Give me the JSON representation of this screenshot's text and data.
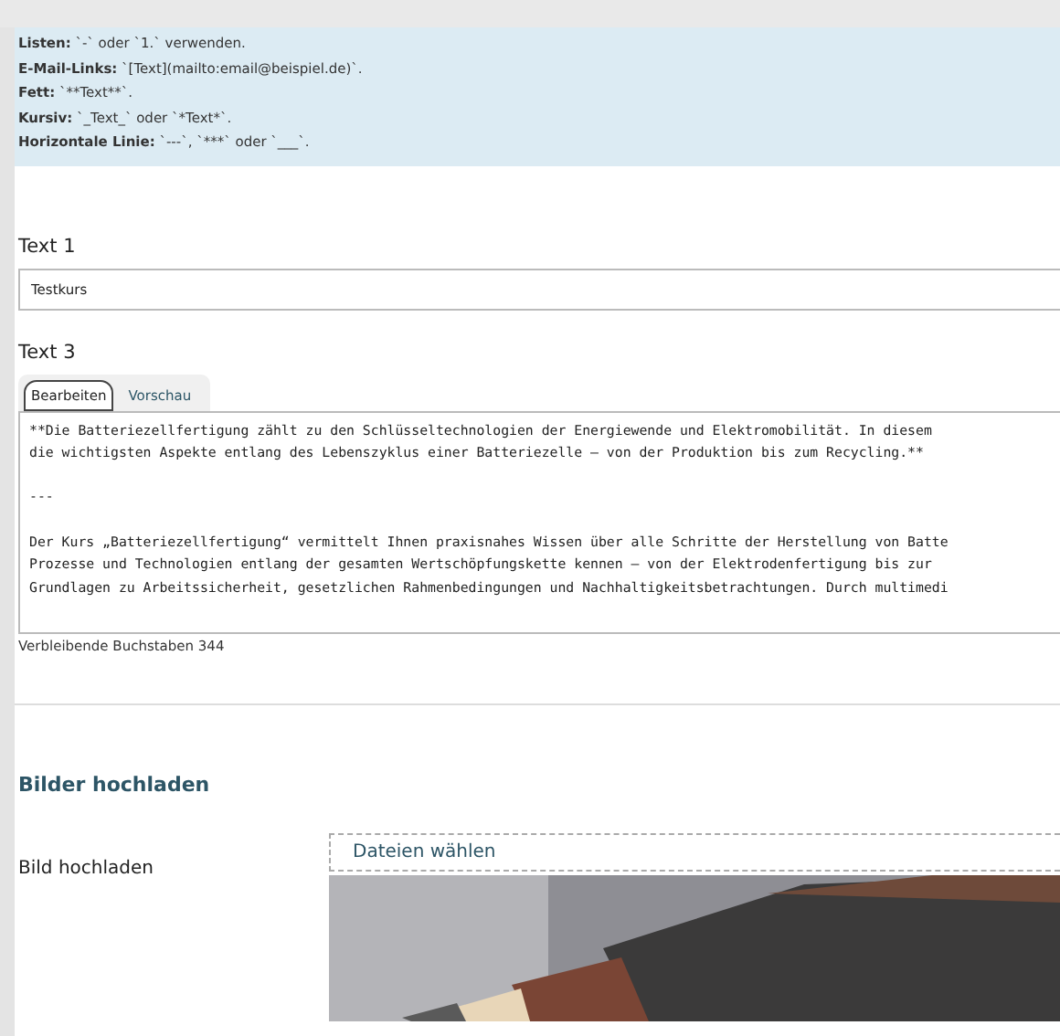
{
  "help_lines": [
    {
      "label": "Listen:",
      "text": "`-` oder `1.` verwenden."
    },
    {
      "label": "E-Mail-Links:",
      "text": "`[Text](mailto:email@beispiel.de)`."
    },
    {
      "label": "Fett:",
      "text": "`**Text**`."
    },
    {
      "label": "Kursiv:",
      "text": "`_Text_` oder `*Text*`."
    },
    {
      "label": "Horizontale Linie:",
      "text": "`---`, `***` oder `___`."
    }
  ],
  "text1": {
    "label": "Text 1",
    "value": "Testkurs"
  },
  "text3": {
    "label": "Text 3",
    "tabs": [
      {
        "label": "Bearbeiten",
        "selected": true
      },
      {
        "label": "Vorschau",
        "selected": false
      }
    ],
    "paragraphs": [
      [
        "**Die Batteriezellfertigung zählt zu den Schlüsseltechnologien der Energiewende und Elektromobilität. In diesem",
        "die wichtigsten Aspekte entlang des Lebenszyklus einer Batteriezelle – von der Produktion bis zum Recycling.**"
      ],
      [
        "---"
      ],
      [
        "Der Kurs „Batteriezellfertigung“ vermittelt Ihnen praxisnahes Wissen über alle Schritte der Herstellung von Batte",
        "Prozesse und Technologien entlang der gesamten Wertschöpfungskette kennen – von der Elektrodenfertigung bis zur",
        "Grundlagen zu Arbeitssicherheit, gesetzlichen Rahmenbedingungen und Nachhaltigkeitsbetrachtungen. Durch multimedi"
      ]
    ],
    "counter": "Verbleibende Buchstaben 344"
  },
  "upload": {
    "heading": "Bilder hochladen",
    "label": "Bild hochladen",
    "button": "Dateien wählen"
  }
}
